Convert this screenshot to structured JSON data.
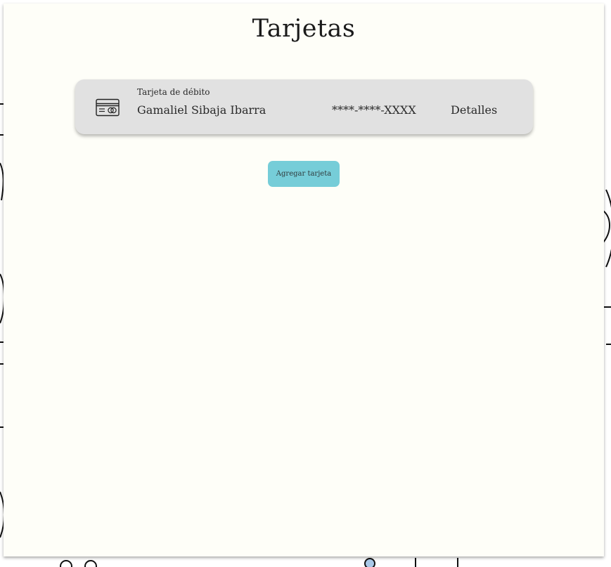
{
  "page": {
    "title": "Tarjetas"
  },
  "cards": [
    {
      "type_label": "Tarjeta de débito",
      "holder": "Gamaliel Sibaja Ibarra",
      "number": "****-****-XXXX",
      "details_label": "Detalles",
      "icon": "credit-card-icon"
    }
  ],
  "actions": {
    "add_card_label": "Agregar tarjeta"
  },
  "colors": {
    "panel_background": "#fefef8",
    "card_background": "#e1e1e1",
    "button_accent": "#76cdd8",
    "text": "#2a2a2a"
  }
}
